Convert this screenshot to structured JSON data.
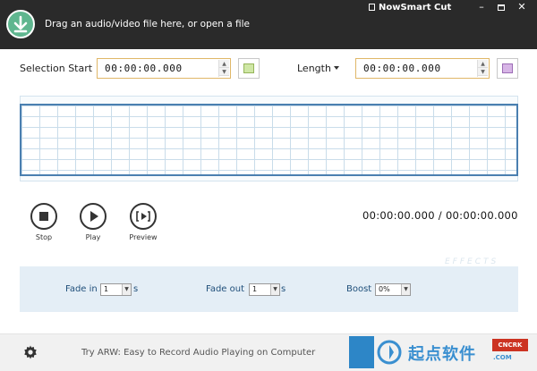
{
  "window": {
    "title": "NowSmart Cut",
    "controls": {
      "minimize": "–",
      "close": "✕"
    }
  },
  "header": {
    "drop_text": "Drag an audio/video file here, or open a file",
    "open_icon": "download-arrow-icon",
    "colors": {
      "bar": "#2a2a2a",
      "open_button": "#5fb68f"
    }
  },
  "selection": {
    "start_label": "Selection Start",
    "start_value": "00:00:00.000",
    "length_label": "Length",
    "length_value": "00:00:00.000",
    "start_color": "#cfe7a5",
    "length_color": "#d7b5e6"
  },
  "player": {
    "stop_label": "Stop",
    "play_label": "Play",
    "preview_label": "Preview",
    "time_display": "00:00:00.000 / 00:00:00.000"
  },
  "effects": {
    "title": "EFFECTS",
    "fade_in_label": "Fade in",
    "fade_in_value": "1",
    "fade_out_label": "Fade out",
    "fade_out_value": "1",
    "unit": "s",
    "boost_label": "Boost",
    "boost_value": "0%"
  },
  "footer": {
    "promo_text": "Try ARW: Easy to Record Audio Playing on Computer",
    "watermark_text": "起点软件",
    "watermark_badge": "CNCRK",
    "watermark_domain": ".COM"
  }
}
